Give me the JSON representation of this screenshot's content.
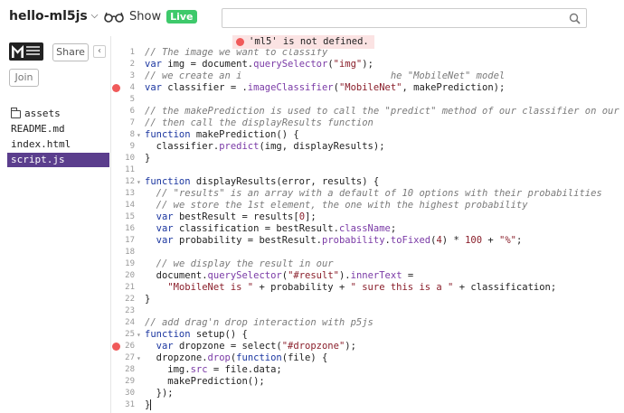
{
  "header": {
    "project_name": "hello-ml5js",
    "show_label": "Show",
    "live_label": "Live",
    "search": {
      "placeholder": "",
      "value": ""
    }
  },
  "sidebar": {
    "share_label": "Share",
    "collapse_label": "‹",
    "join_label": "Join",
    "files": [
      "assets",
      "README.md",
      "index.html",
      "script.js"
    ],
    "active_file": "script.js"
  },
  "editor": {
    "error_message": "'ml5' is not defined.",
    "lines": [
      {
        "n": "1",
        "fold": "",
        "bp": false,
        "code": "// The image we want to classify"
      },
      {
        "n": "2",
        "fold": "",
        "bp": false,
        "code": "var img = document.querySelector(\"img\");"
      },
      {
        "n": "3",
        "fold": "",
        "bp": false,
        "code": "// we create an i                          he \"MobileNet\" model"
      },
      {
        "n": "4",
        "fold": "",
        "bp": true,
        "code": "var classifier = ml5.imageClassifier(\"MobileNet\", makePrediction);"
      },
      {
        "n": "5",
        "fold": "",
        "bp": false,
        "code": ""
      },
      {
        "n": "6",
        "fold": "",
        "bp": false,
        "code": "// the makePrediction is used to call the \"predict\" method of our classifier on our image"
      },
      {
        "n": "7",
        "fold": "",
        "bp": false,
        "code": "// then call the displayResults function"
      },
      {
        "n": "8",
        "fold": "▾",
        "bp": false,
        "code": "function makePrediction() {"
      },
      {
        "n": "9",
        "fold": "",
        "bp": false,
        "code": "  classifier.predict(img, displayResults);"
      },
      {
        "n": "10",
        "fold": "",
        "bp": false,
        "code": "}"
      },
      {
        "n": "11",
        "fold": "",
        "bp": false,
        "code": ""
      },
      {
        "n": "12",
        "fold": "▾",
        "bp": false,
        "code": "function displayResults(error, results) {"
      },
      {
        "n": "13",
        "fold": "",
        "bp": false,
        "code": "  // \"results\" is an array with a default of 10 options with their probabilities"
      },
      {
        "n": "14",
        "fold": "",
        "bp": false,
        "code": "  // we store the 1st element, the one with the highest probability"
      },
      {
        "n": "15",
        "fold": "",
        "bp": false,
        "code": "  var bestResult = results[0];"
      },
      {
        "n": "16",
        "fold": "",
        "bp": false,
        "code": "  var classification = bestResult.className;"
      },
      {
        "n": "17",
        "fold": "",
        "bp": false,
        "code": "  var probability = bestResult.probability.toFixed(4) * 100 + \"%\";"
      },
      {
        "n": "18",
        "fold": "",
        "bp": false,
        "code": ""
      },
      {
        "n": "19",
        "fold": "",
        "bp": false,
        "code": "  // we display the result in our"
      },
      {
        "n": "20",
        "fold": "",
        "bp": false,
        "code": "  document.querySelector(\"#result\").innerText ="
      },
      {
        "n": "21",
        "fold": "",
        "bp": false,
        "code": "    \"MobileNet is \" + probability + \" sure this is a \" + classification;"
      },
      {
        "n": "22",
        "fold": "",
        "bp": false,
        "code": "}"
      },
      {
        "n": "23",
        "fold": "",
        "bp": false,
        "code": ""
      },
      {
        "n": "24",
        "fold": "",
        "bp": false,
        "code": "// add drag'n drop interaction with p5js"
      },
      {
        "n": "25",
        "fold": "▾",
        "bp": false,
        "code": "function setup() {"
      },
      {
        "n": "26",
        "fold": "",
        "bp": true,
        "code": "  var dropzone = select(\"#dropzone\");"
      },
      {
        "n": "27",
        "fold": "▾",
        "bp": false,
        "code": "  dropzone.drop(function(file) {"
      },
      {
        "n": "28",
        "fold": "",
        "bp": false,
        "code": "    img.src = file.data;"
      },
      {
        "n": "29",
        "fold": "",
        "bp": false,
        "code": "    makePrediction();"
      },
      {
        "n": "30",
        "fold": "",
        "bp": false,
        "code": "  });"
      },
      {
        "n": "31",
        "fold": "",
        "bp": false,
        "code": "}"
      }
    ]
  },
  "colors": {
    "accent": "#5b3e8d",
    "live": "#3ec96b",
    "error": "#f05a5a"
  }
}
